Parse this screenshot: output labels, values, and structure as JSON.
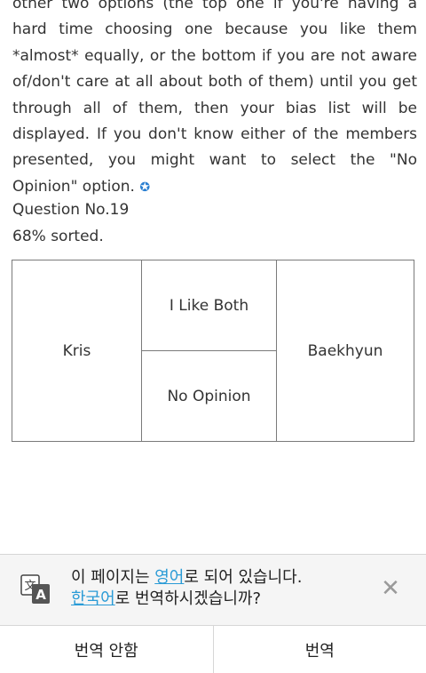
{
  "intro": {
    "text": "other two options (the top one if you're having a hard time choosing one because you like them *almost* equally, or the bottom if you are not aware of/don't care at all about both of them) until you get through all of them, then your bias list will be displayed. If you don't know either of the members presented, you might want to select the \"No Opinion\" option.",
    "star": "✪"
  },
  "question": {
    "number_label": "Question No.19",
    "progress_label": "68% sorted."
  },
  "sorter": {
    "left_option": "Kris",
    "both_option": "I Like Both",
    "no_opinion_option": "No Opinion",
    "right_option": "Baekhyun"
  },
  "translate_bar": {
    "line1_prefix": "이 페이지는 ",
    "line1_lang": "영어",
    "line1_suffix": "로 되어 있습니다.",
    "line2_lang": "한국어",
    "line2_suffix": "로 번역하시겠습니까?",
    "icon": "translate-icon",
    "close_icon": "close-icon",
    "close_glyph": "✕",
    "no_button": "번역 안함",
    "yes_button": "번역",
    "accent": "#2a9bd6"
  }
}
